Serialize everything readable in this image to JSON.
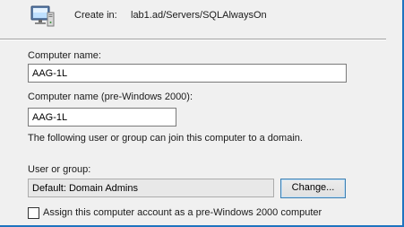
{
  "header": {
    "create_in_label": "Create in:",
    "create_in_path": "lab1.ad/Servers/SQLAlwaysOn",
    "icon": "computer-icon"
  },
  "form": {
    "computer_name_label": "Computer name:",
    "computer_name_value": "AAG-1L",
    "pre2000_label": "Computer name (pre-Windows 2000):",
    "pre2000_value": "AAG-1L",
    "join_note": "The following user or group can join this computer to a domain.",
    "user_group_label": "User or group:",
    "user_group_value": "Default: Domain Admins",
    "change_button": "Change...",
    "checkbox_label": "Assign this computer account as a pre-Windows 2000 computer",
    "checkbox_checked": false
  },
  "colors": {
    "window_border": "#1f74bf",
    "background": "#f0f0f0"
  }
}
